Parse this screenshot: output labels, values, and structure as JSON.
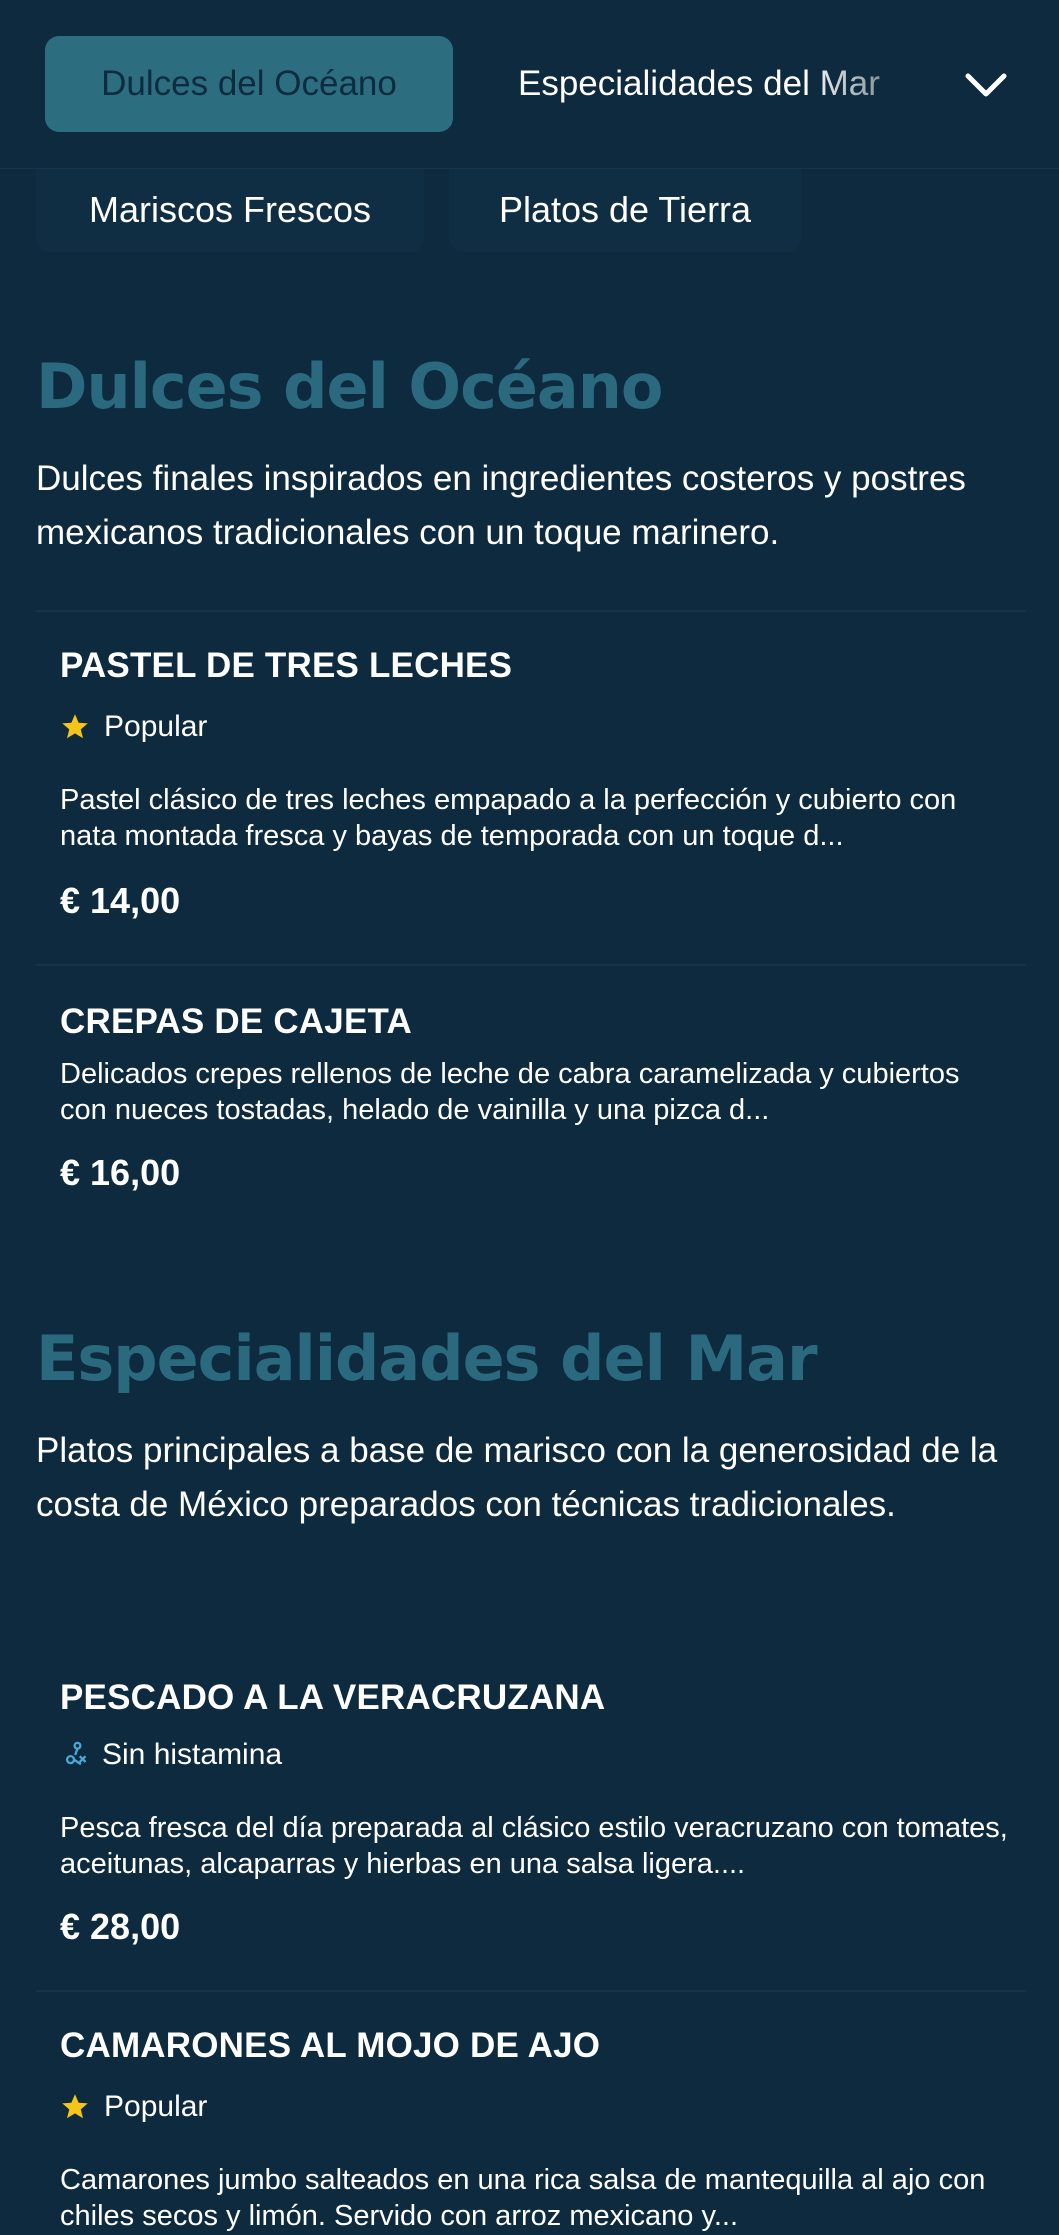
{
  "nav": {
    "active_category": "Dulces del Océano",
    "next_category": "Especialidades del Mar",
    "chips": [
      "Mariscos Frescos",
      "Platos de Tierra"
    ]
  },
  "sections": [
    {
      "title": "Dulces del Océano",
      "description": "Dulces finales inspirados en ingredientes costeros y postres mexicanos tradicionales con un toque marinero.",
      "items": [
        {
          "name": "PASTEL DE TRES LECHES",
          "tag": "Popular",
          "tag_icon": "star-icon",
          "description": "Pastel clásico de tres leches empapado a la perfección y cubierto con nata montada fresca y bayas de temporada con un toque d...",
          "price": "€ 14,00"
        },
        {
          "name": "CREPAS DE CAJETA",
          "description": "Delicados crepes rellenos de leche de cabra caramelizada y cubiertos con nueces tostadas, helado de vainilla y una pizca d...",
          "price": "€ 16,00"
        }
      ]
    },
    {
      "title": "Especialidades del Mar",
      "description": "Platos principales a base de marisco con la generosidad de la costa de México preparados con técnicas tradicionales.",
      "items": [
        {
          "name": "PESCADO A LA VERACRUZANA",
          "tag": "Sin histamina",
          "tag_icon": "histamine-free-icon",
          "description": "Pesca fresca del día preparada al clásico estilo veracruzano con tomates, aceitunas, alcaparras y hierbas en una salsa ligera....",
          "price": "€ 28,00"
        },
        {
          "name": "CAMARONES AL MOJO DE AJO",
          "tag": "Popular",
          "tag_icon": "star-icon",
          "description": "Camarones jumbo salteados en una rica salsa de mantequilla al ajo con chiles secos y limón. Servido con arroz mexicano y..."
        }
      ]
    }
  ],
  "colors": {
    "background": "#0d2a3e",
    "accent": "#2d6d80",
    "heading": "#2b6a7e",
    "star": "#f5c518",
    "histamine_icon": "#4aa8d8"
  }
}
